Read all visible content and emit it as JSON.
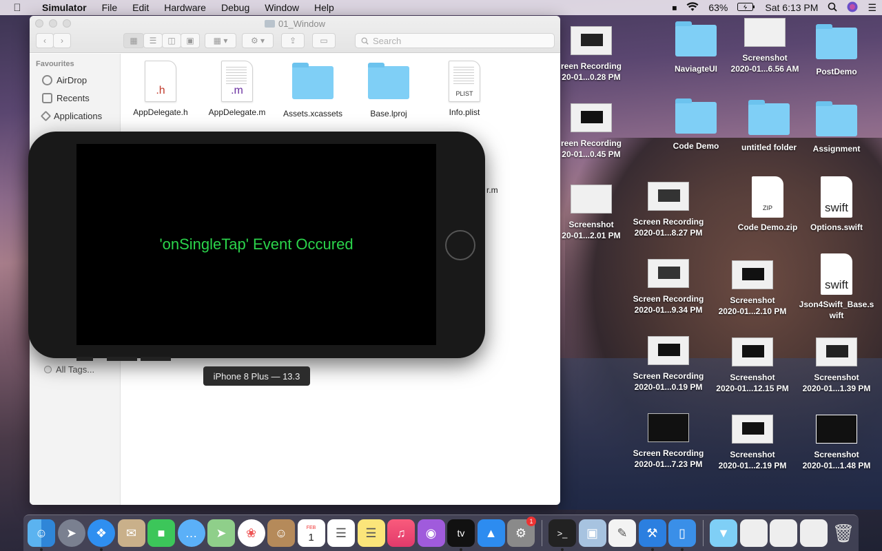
{
  "menubar": {
    "items": [
      "Simulator",
      "File",
      "Edit",
      "Hardware",
      "Debug",
      "Window",
      "Help"
    ],
    "battery": "63%",
    "clock": "Sat 6:13 PM"
  },
  "finder": {
    "title": "01_Window",
    "search_placeholder": "Search",
    "sidebar": {
      "heading": "Favourites",
      "items": [
        "AirDrop",
        "Recents",
        "Applications"
      ],
      "all_tags": "All Tags..."
    },
    "files": [
      {
        "name": "AppDelegate.h",
        "ext": ".h",
        "kind": "doc"
      },
      {
        "name": "AppDelegate.m",
        "ext": ".m",
        "kind": "doc"
      },
      {
        "name": "Assets.xcassets",
        "ext": "",
        "kind": "folder"
      },
      {
        "name": "Base.lproj",
        "ext": "",
        "kind": "folder"
      },
      {
        "name": "Info.plist",
        "ext": "PLIST",
        "kind": "doc"
      }
    ],
    "partial_label": "r.m"
  },
  "simulator": {
    "message": "'onSingleTap' Event Occured",
    "tooltip": "iPhone 8 Plus — 13.3"
  },
  "desktop": {
    "col1": [
      {
        "l1": "reen Recording",
        "l2": "20-01...0.28 PM"
      },
      {
        "l1": "reen Recording",
        "l2": "20-01...0.45 PM"
      },
      {
        "l1": "Screenshot",
        "l2": "20-01...2.01 PM"
      }
    ],
    "grid": [
      {
        "l1": "NaviagteUI",
        "l2": ""
      },
      {
        "l1": "Screenshot",
        "l2": "2020-01...6.56 AM"
      },
      {
        "l1": "PostDemo",
        "l2": ""
      },
      {
        "l1": "Code Demo",
        "l2": ""
      },
      {
        "l1": "untitled folder",
        "l2": ""
      },
      {
        "l1": "Assignment",
        "l2": ""
      },
      {
        "l1": "Screen Recording",
        "l2": "2020-01...8.27 PM"
      },
      {
        "l1": "Code Demo.zip",
        "l2": ""
      },
      {
        "l1": "Options.swift",
        "l2": ""
      },
      {
        "l1": "Screen Recording",
        "l2": "2020-01...9.34 PM"
      },
      {
        "l1": "Screenshot",
        "l2": "2020-01...2.10 PM"
      },
      {
        "l1": "Json4Swift_Base.s",
        "l2": "wift"
      },
      {
        "l1": "Screen Recording",
        "l2": "2020-01...0.19 PM"
      },
      {
        "l1": "Screenshot",
        "l2": "2020-01...12.15 PM"
      },
      {
        "l1": "Screenshot",
        "l2": "2020-01...1.39 PM"
      },
      {
        "l1": "Screen Recording",
        "l2": "2020-01...7.23 PM"
      },
      {
        "l1": "Screenshot",
        "l2": "2020-01...2.19 PM"
      },
      {
        "l1": "Screenshot",
        "l2": "2020-01...1.48 PM"
      }
    ],
    "ext_labels": {
      "zip": "ZIP",
      "swift": "swift"
    }
  },
  "dock": {
    "apps": [
      "Finder",
      "Launchpad",
      "Safari",
      "Mail",
      "FaceTime",
      "Messages",
      "Maps",
      "Photos",
      "Contacts",
      "Calendar",
      "Reminders",
      "Notes",
      "Music",
      "Podcasts",
      "TV",
      "App Store",
      "System Preferences",
      "Terminal",
      "Preview",
      "TextEdit",
      "Xcode",
      "Simulator",
      "Downloads",
      "Screenshot",
      "Screenshot",
      "Screenshot",
      "Trash"
    ],
    "calendar_month": "FEB",
    "calendar_day": "1",
    "tv_label": "tv",
    "sysprefs_badge": "1"
  }
}
